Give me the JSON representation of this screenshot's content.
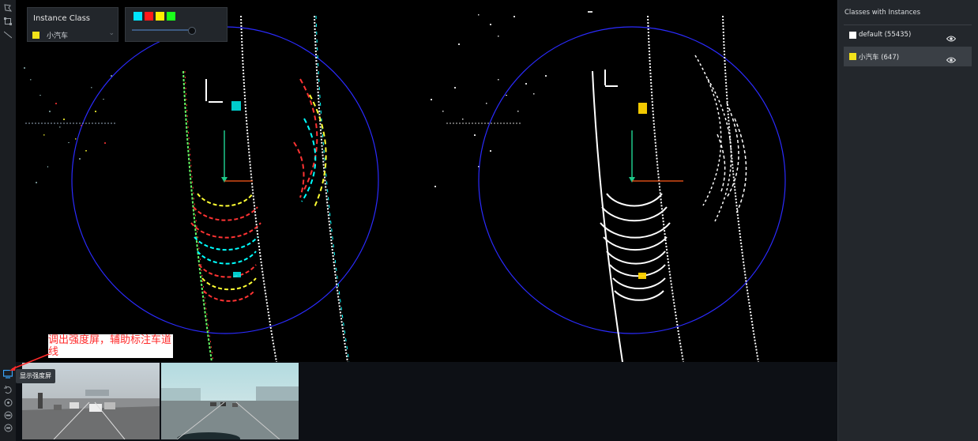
{
  "instance_panel": {
    "title": "Instance Class",
    "selected_class": "小汽车",
    "selected_color": "#f2e21a"
  },
  "color_panel": {
    "colors": [
      "#00e5ff",
      "#ff1a1a",
      "#ffee00",
      "#1aff1a"
    ],
    "slider_value": 0.9
  },
  "classes_panel": {
    "title": "Classes with Instances",
    "items": [
      {
        "label": "default (55435)",
        "color": "#ffffff"
      },
      {
        "label": "小汽车 (647)",
        "color": "#f2e21a"
      }
    ]
  },
  "tooltip": "显示强度屏",
  "annotation": "调出强度屏，辅助标注车道线",
  "toolbar": {
    "icons": [
      "select-polygon-icon",
      "bounding-box-icon",
      "line-tool-icon",
      "intensity-screen-icon",
      "rotate-icon",
      "reset-view-icon",
      "view-270-icon",
      "view-180-icon"
    ]
  },
  "colors": {
    "range_circle": "#2b2bff",
    "heading_arrow": "#1ec98a",
    "x_axis": "#ff5a1a",
    "car_point": "#ffd400"
  }
}
